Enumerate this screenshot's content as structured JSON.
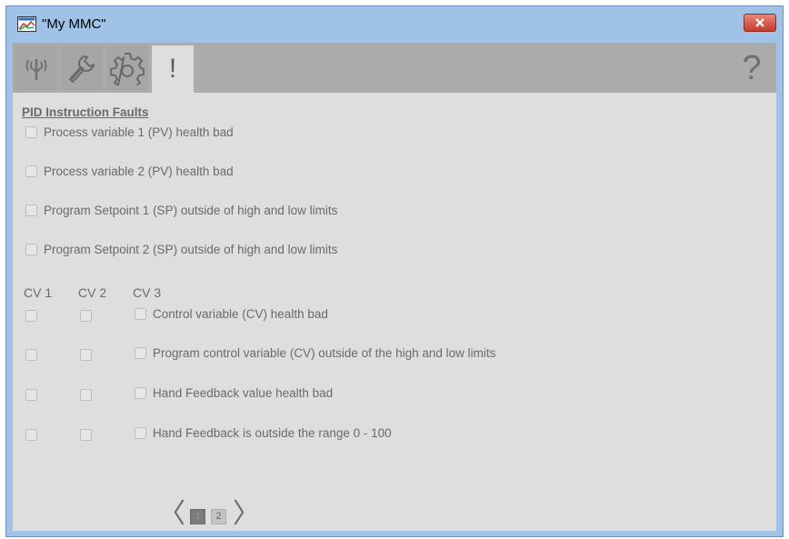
{
  "window": {
    "title": "\"My MMC\"",
    "close_icon": "close-icon"
  },
  "toolbar": {
    "buttons": [
      {
        "icon": "signal-antenna-icon"
      },
      {
        "icon": "wrench-icon"
      },
      {
        "icon": "gear-icon"
      },
      {
        "icon": "exclamation-icon",
        "label": "!"
      }
    ],
    "help_label": "?"
  },
  "faults": {
    "section_title": "PID Instruction Faults",
    "pid_items": [
      {
        "label": "Process variable 1 (PV) health bad",
        "checked": false
      },
      {
        "label": "Process variable 2 (PV) health bad",
        "checked": false
      },
      {
        "label": "Program Setpoint 1 (SP) outside of high and low limits",
        "checked": false
      },
      {
        "label": "Program Setpoint 2 (SP) outside of high and low limits",
        "checked": false
      }
    ],
    "cv_headers": [
      "CV 1",
      "CV 2",
      "CV 3"
    ],
    "cv_items": [
      {
        "label": "Control variable (CV) health bad"
      },
      {
        "label": "Program control variable (CV) outside of the high and low limits"
      },
      {
        "label": "Hand Feedback value health bad"
      },
      {
        "label": "Hand Feedback is outside the range 0 - 100"
      }
    ]
  },
  "pager": {
    "prev": "〈",
    "next": "〉",
    "pages": [
      "1",
      "2"
    ],
    "current_page": "1"
  },
  "colors": {
    "titlebar": "#9fc2e6",
    "panel": "#dedede",
    "toolbar": "#ababab",
    "close_button": "#c63c2c"
  }
}
